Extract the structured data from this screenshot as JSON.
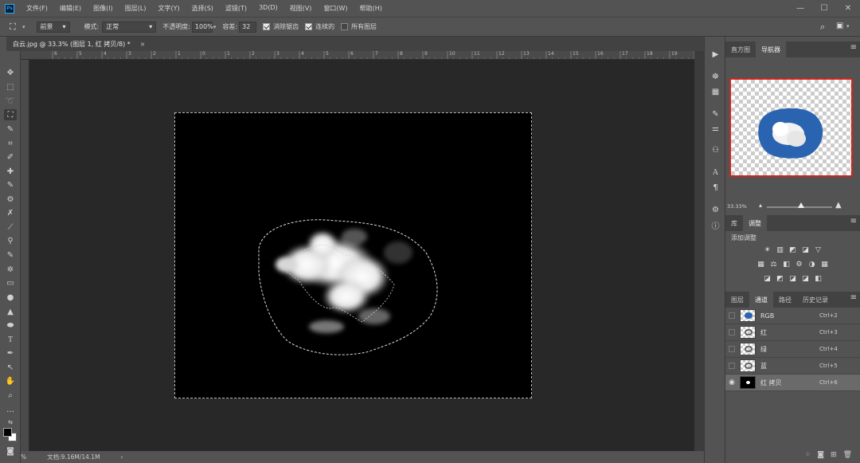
{
  "app": {
    "logo_text": "Ps"
  },
  "menu": [
    "文件(F)",
    "编辑(E)",
    "图像(I)",
    "图层(L)",
    "文字(Y)",
    "选择(S)",
    "滤镜(T)",
    "3D(D)",
    "视图(V)",
    "窗口(W)",
    "帮助(H)"
  ],
  "window_controls": {
    "minimize": "—",
    "maximize": "☐",
    "close": "✕"
  },
  "options": {
    "fill_source": "前景",
    "mode_label": "模式:",
    "mode_value": "正常",
    "opacity_label": "不透明度:",
    "opacity_value": "100%",
    "tolerance_label": "容差:",
    "tolerance_value": "32",
    "antialias_label": "消除锯齿",
    "antialias_checked": true,
    "contiguous_label": "连续的",
    "contiguous_checked": true,
    "all_layers_label": "所有图层",
    "all_layers_checked": false
  },
  "document": {
    "tab_title": "白云.jpg @ 33.3% (图层 1, 红 拷贝/8) *",
    "close": "×"
  },
  "ruler_h_labels": [
    "6",
    "5",
    "4",
    "3",
    "2",
    "1",
    "0",
    "1",
    "2",
    "3",
    "4",
    "5",
    "6",
    "7",
    "8",
    "9",
    "10",
    "11",
    "12",
    "13",
    "14",
    "15",
    "16",
    "17",
    "18",
    "19",
    "20"
  ],
  "status": {
    "zoom": "%",
    "doc_info": "文档:9.16M/14.1M",
    "arrow": "›"
  },
  "navigator": {
    "tabs": [
      "直方图",
      "导航器"
    ],
    "active_tab": 1,
    "zoom_value": "33.33%",
    "zoom_fraction": 0.52
  },
  "adjustments": {
    "tabs": [
      "库",
      "调整"
    ],
    "active_tab": 1,
    "title": "添加调整",
    "rows": [
      [
        "☀",
        "▥",
        "◩",
        "◪",
        "▽"
      ],
      [
        "▦",
        "⚖",
        "◧",
        "⚙",
        "◑",
        "▦"
      ],
      [
        "◪",
        "◩",
        "◪",
        "◪",
        "◧"
      ]
    ]
  },
  "channels": {
    "tabs": [
      "图层",
      "通道",
      "路径",
      "历史记录"
    ],
    "active_tab": 1,
    "items": [
      {
        "name": "RGB",
        "shortcut": "Ctrl+2",
        "visible": false,
        "active": false
      },
      {
        "name": "红",
        "shortcut": "Ctrl+3",
        "visible": false,
        "active": false
      },
      {
        "name": "绿",
        "shortcut": "Ctrl+4",
        "visible": false,
        "active": false
      },
      {
        "name": "蓝",
        "shortcut": "Ctrl+5",
        "visible": false,
        "active": false
      },
      {
        "name": "红 拷贝",
        "shortcut": "Ctrl+6",
        "visible": true,
        "active": true
      }
    ]
  },
  "colors": {
    "accent_red": "#d0231d",
    "sky_blue": "#2a64b0",
    "active_row": "#6a6a6a"
  }
}
